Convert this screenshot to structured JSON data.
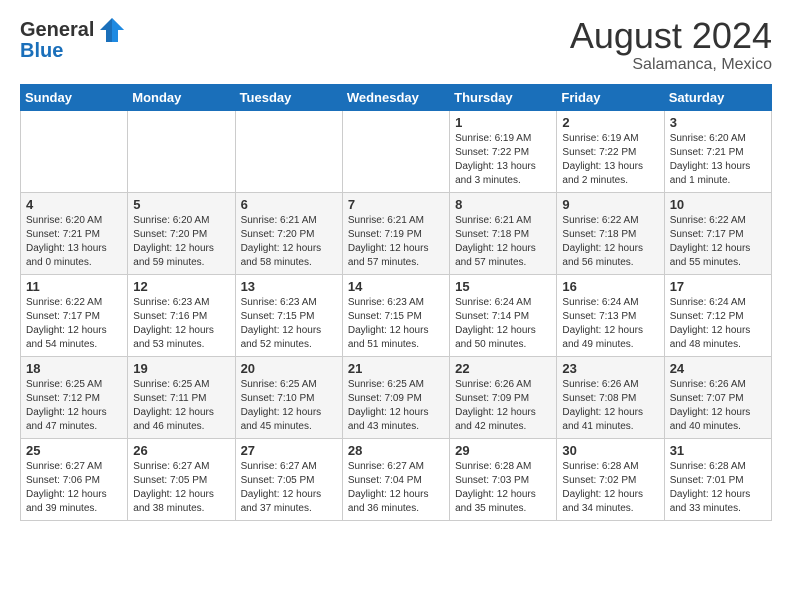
{
  "logo": {
    "general": "General",
    "blue": "Blue"
  },
  "header": {
    "month_year": "August 2024",
    "location": "Salamanca, Mexico"
  },
  "days_of_week": [
    "Sunday",
    "Monday",
    "Tuesday",
    "Wednesday",
    "Thursday",
    "Friday",
    "Saturday"
  ],
  "weeks": [
    [
      {
        "day": "",
        "content": ""
      },
      {
        "day": "",
        "content": ""
      },
      {
        "day": "",
        "content": ""
      },
      {
        "day": "",
        "content": ""
      },
      {
        "day": "1",
        "content": "Sunrise: 6:19 AM\nSunset: 7:22 PM\nDaylight: 13 hours\nand 3 minutes."
      },
      {
        "day": "2",
        "content": "Sunrise: 6:19 AM\nSunset: 7:22 PM\nDaylight: 13 hours\nand 2 minutes."
      },
      {
        "day": "3",
        "content": "Sunrise: 6:20 AM\nSunset: 7:21 PM\nDaylight: 13 hours\nand 1 minute."
      }
    ],
    [
      {
        "day": "4",
        "content": "Sunrise: 6:20 AM\nSunset: 7:21 PM\nDaylight: 13 hours\nand 0 minutes."
      },
      {
        "day": "5",
        "content": "Sunrise: 6:20 AM\nSunset: 7:20 PM\nDaylight: 12 hours\nand 59 minutes."
      },
      {
        "day": "6",
        "content": "Sunrise: 6:21 AM\nSunset: 7:20 PM\nDaylight: 12 hours\nand 58 minutes."
      },
      {
        "day": "7",
        "content": "Sunrise: 6:21 AM\nSunset: 7:19 PM\nDaylight: 12 hours\nand 57 minutes."
      },
      {
        "day": "8",
        "content": "Sunrise: 6:21 AM\nSunset: 7:18 PM\nDaylight: 12 hours\nand 57 minutes."
      },
      {
        "day": "9",
        "content": "Sunrise: 6:22 AM\nSunset: 7:18 PM\nDaylight: 12 hours\nand 56 minutes."
      },
      {
        "day": "10",
        "content": "Sunrise: 6:22 AM\nSunset: 7:17 PM\nDaylight: 12 hours\nand 55 minutes."
      }
    ],
    [
      {
        "day": "11",
        "content": "Sunrise: 6:22 AM\nSunset: 7:17 PM\nDaylight: 12 hours\nand 54 minutes."
      },
      {
        "day": "12",
        "content": "Sunrise: 6:23 AM\nSunset: 7:16 PM\nDaylight: 12 hours\nand 53 minutes."
      },
      {
        "day": "13",
        "content": "Sunrise: 6:23 AM\nSunset: 7:15 PM\nDaylight: 12 hours\nand 52 minutes."
      },
      {
        "day": "14",
        "content": "Sunrise: 6:23 AM\nSunset: 7:15 PM\nDaylight: 12 hours\nand 51 minutes."
      },
      {
        "day": "15",
        "content": "Sunrise: 6:24 AM\nSunset: 7:14 PM\nDaylight: 12 hours\nand 50 minutes."
      },
      {
        "day": "16",
        "content": "Sunrise: 6:24 AM\nSunset: 7:13 PM\nDaylight: 12 hours\nand 49 minutes."
      },
      {
        "day": "17",
        "content": "Sunrise: 6:24 AM\nSunset: 7:12 PM\nDaylight: 12 hours\nand 48 minutes."
      }
    ],
    [
      {
        "day": "18",
        "content": "Sunrise: 6:25 AM\nSunset: 7:12 PM\nDaylight: 12 hours\nand 47 minutes."
      },
      {
        "day": "19",
        "content": "Sunrise: 6:25 AM\nSunset: 7:11 PM\nDaylight: 12 hours\nand 46 minutes."
      },
      {
        "day": "20",
        "content": "Sunrise: 6:25 AM\nSunset: 7:10 PM\nDaylight: 12 hours\nand 45 minutes."
      },
      {
        "day": "21",
        "content": "Sunrise: 6:25 AM\nSunset: 7:09 PM\nDaylight: 12 hours\nand 43 minutes."
      },
      {
        "day": "22",
        "content": "Sunrise: 6:26 AM\nSunset: 7:09 PM\nDaylight: 12 hours\nand 42 minutes."
      },
      {
        "day": "23",
        "content": "Sunrise: 6:26 AM\nSunset: 7:08 PM\nDaylight: 12 hours\nand 41 minutes."
      },
      {
        "day": "24",
        "content": "Sunrise: 6:26 AM\nSunset: 7:07 PM\nDaylight: 12 hours\nand 40 minutes."
      }
    ],
    [
      {
        "day": "25",
        "content": "Sunrise: 6:27 AM\nSunset: 7:06 PM\nDaylight: 12 hours\nand 39 minutes."
      },
      {
        "day": "26",
        "content": "Sunrise: 6:27 AM\nSunset: 7:05 PM\nDaylight: 12 hours\nand 38 minutes."
      },
      {
        "day": "27",
        "content": "Sunrise: 6:27 AM\nSunset: 7:05 PM\nDaylight: 12 hours\nand 37 minutes."
      },
      {
        "day": "28",
        "content": "Sunrise: 6:27 AM\nSunset: 7:04 PM\nDaylight: 12 hours\nand 36 minutes."
      },
      {
        "day": "29",
        "content": "Sunrise: 6:28 AM\nSunset: 7:03 PM\nDaylight: 12 hours\nand 35 minutes."
      },
      {
        "day": "30",
        "content": "Sunrise: 6:28 AM\nSunset: 7:02 PM\nDaylight: 12 hours\nand 34 minutes."
      },
      {
        "day": "31",
        "content": "Sunrise: 6:28 AM\nSunset: 7:01 PM\nDaylight: 12 hours\nand 33 minutes."
      }
    ]
  ]
}
